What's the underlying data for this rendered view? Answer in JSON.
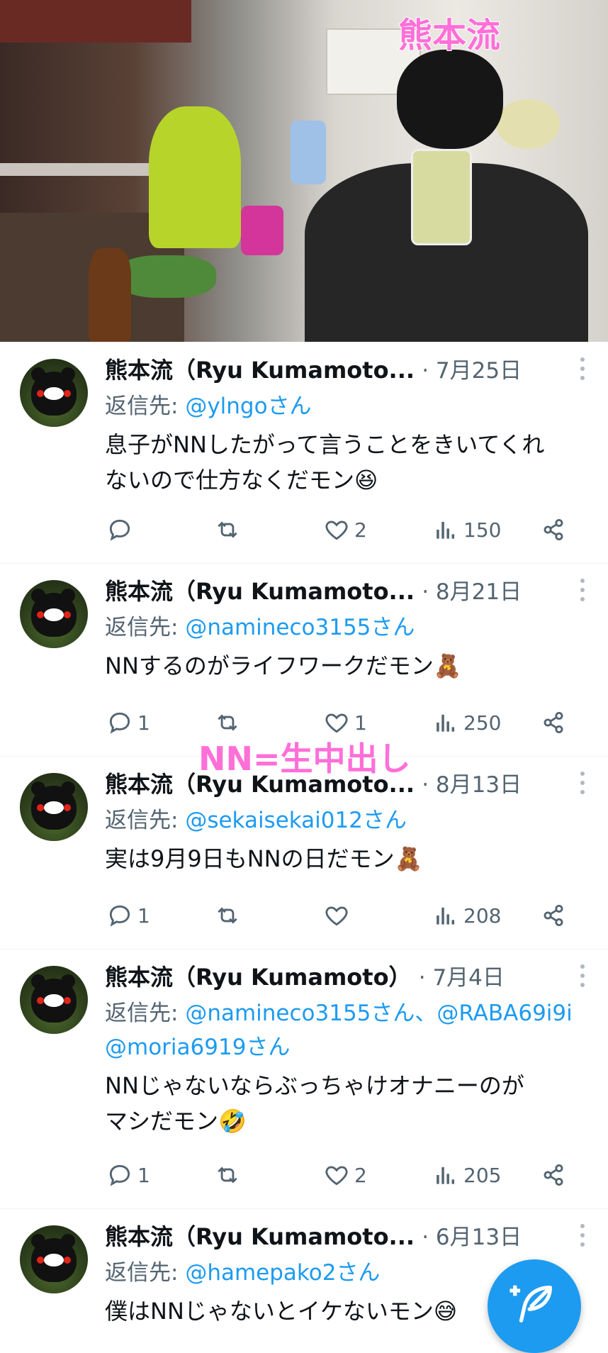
{
  "photo": {
    "overlay_text": "熊本流"
  },
  "overlay_label": "NN=生中出し",
  "tweets": [
    {
      "name": "熊本流（Ryu Kumamoto...",
      "date": "· 7月25日",
      "reply_prefix": "返信先: ",
      "reply_handles": "@ylngoさん",
      "body_lines": [
        "息子がNNしたがって言うことをきいてくれ",
        "ないので仕方なくだモン😆"
      ],
      "stats": {
        "reply": "",
        "retweet": "",
        "like": "2",
        "views": "150"
      }
    },
    {
      "name": "熊本流（Ryu Kumamoto...",
      "date": "· 8月21日",
      "reply_prefix": "返信先: ",
      "reply_handles": "@namineco3155さん",
      "body_lines": [
        "NNするのがライフワークだモン🧸"
      ],
      "stats": {
        "reply": "1",
        "retweet": "",
        "like": "1",
        "views": "250"
      }
    },
    {
      "name": "熊本流（Ryu Kumamoto...",
      "date": "· 8月13日",
      "reply_prefix": "返信先: ",
      "reply_handles": "@sekaisekai012さん",
      "body_lines": [
        "実は9月9日もNNの日だモン🧸"
      ],
      "stats": {
        "reply": "1",
        "retweet": "",
        "like": "",
        "views": "208"
      }
    },
    {
      "name": "熊本流（Ryu Kumamoto）",
      "date": "· 7月4日",
      "reply_prefix": "返信先: ",
      "reply_handles": "@namineco3155さん、@RABA69i9i",
      "reply_handles_2": "@moria6919さん",
      "body_lines": [
        "NNじゃないならぶっちゃけオナニーのが",
        "マシだモン🤣"
      ],
      "stats": {
        "reply": "1",
        "retweet": "",
        "like": "2",
        "views": "205"
      }
    },
    {
      "name": "熊本流（Ryu Kumamoto...",
      "date": "· 6月13日",
      "reply_prefix": "返信先: ",
      "reply_handles": "@hamepako2さん",
      "body_lines": [
        "僕はNNじゃないとイケないモン😅"
      ],
      "stats": null
    }
  ],
  "icons": {
    "reply": "reply-icon",
    "retweet": "retweet-icon",
    "like": "heart-icon",
    "views": "views-icon",
    "share": "share-icon",
    "more": "more-icon",
    "compose": "compose-icon"
  },
  "colors": {
    "link": "#1d9bf0",
    "muted": "#536471",
    "overlay": "#ff6fd8",
    "fab": "#1d9bf0"
  }
}
